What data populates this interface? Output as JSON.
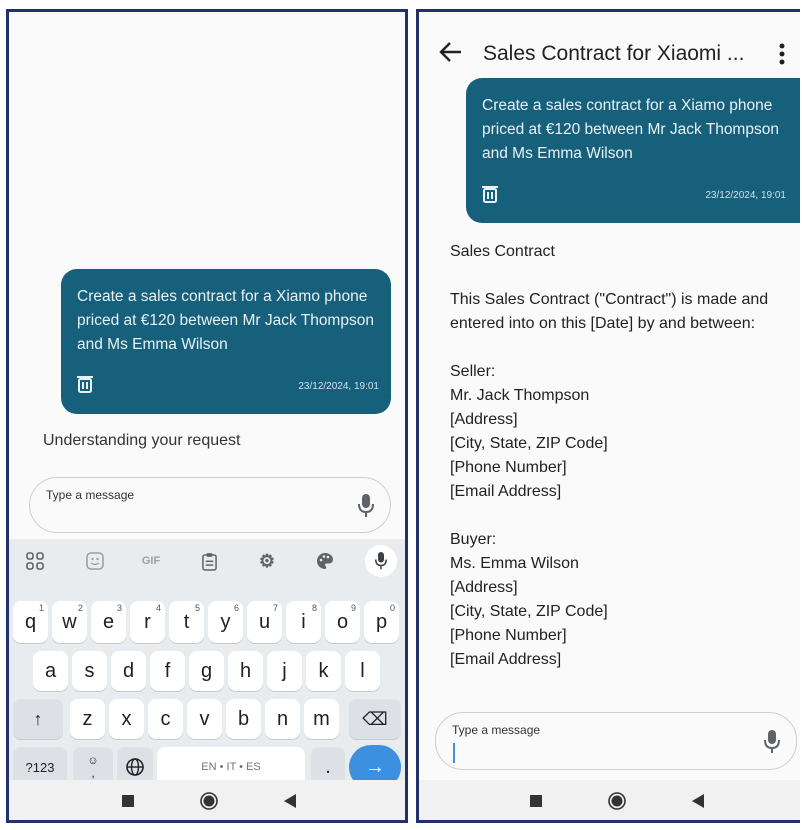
{
  "left": {
    "message": {
      "text": "Create a sales contract for a Xiamo phone priced at €120 between Mr Jack Thompson and Ms Emma Wilson",
      "timestamp": "23/12/2024, 19:01"
    },
    "status": "Understanding your request",
    "input": {
      "placeholder": "Type a message"
    },
    "keyboard": {
      "tools": [
        "apps-icon",
        "sticker-icon",
        "GIF",
        "clipboard-icon",
        "gear-icon",
        "palette-icon",
        "mic-icon"
      ],
      "row1": [
        {
          "k": "q",
          "s": "1"
        },
        {
          "k": "w",
          "s": "2"
        },
        {
          "k": "e",
          "s": "3"
        },
        {
          "k": "r",
          "s": "4"
        },
        {
          "k": "t",
          "s": "5"
        },
        {
          "k": "y",
          "s": "6"
        },
        {
          "k": "u",
          "s": "7"
        },
        {
          "k": "i",
          "s": "8"
        },
        {
          "k": "o",
          "s": "9"
        },
        {
          "k": "p",
          "s": "0"
        }
      ],
      "row2": [
        "a",
        "s",
        "d",
        "f",
        "g",
        "h",
        "j",
        "k",
        "l"
      ],
      "row3": [
        "z",
        "x",
        "c",
        "v",
        "b",
        "n",
        "m"
      ],
      "symbols_label": "?123",
      "comma_label": ",",
      "space_label": "EN • IT • ES",
      "period_label": ".",
      "shift_icon": "↑",
      "backspace_icon": "⌫",
      "enter_icon": "→"
    },
    "nav": [
      "recents-icon",
      "home-icon",
      "back-icon"
    ]
  },
  "right": {
    "header": {
      "title": "Sales Contract for Xiaomi ..."
    },
    "message": {
      "text": "Create a sales contract for a Xiamo phone priced at €120 between Mr Jack Thompson and Ms Emma Wilson",
      "timestamp": "23/12/2024, 19:01"
    },
    "contract": {
      "heading": "Sales Contract",
      "intro": "This Sales Contract (\"Contract\") is made and entered into on this [Date] by and between:",
      "seller": {
        "label": "Seller:",
        "name": "Mr. Jack Thompson",
        "address": "[Address]",
        "city": "[City, State, ZIP Code]",
        "phone": "[Phone Number]",
        "email": "[Email Address]"
      },
      "buyer": {
        "label": "Buyer:",
        "name": "Ms. Emma Wilson",
        "address": "[Address]",
        "city": "[City, State, ZIP Code]",
        "phone": "[Phone Number]",
        "email": "[Email Address]"
      }
    },
    "input": {
      "placeholder": "Type a message"
    },
    "nav": [
      "recents-icon",
      "home-icon",
      "back-icon"
    ]
  },
  "colors": {
    "bubble": "#17607c",
    "frame": "#22306b",
    "enter_key": "#3d8fe0"
  }
}
